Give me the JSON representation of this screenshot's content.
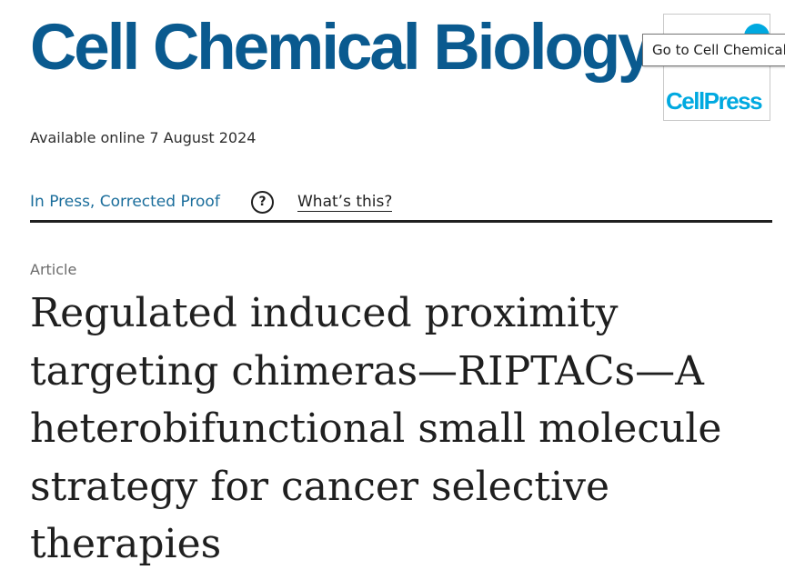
{
  "header": {
    "journal_title": "Cell Chemical Biology",
    "publisher_logo_text": "CellPress",
    "tooltip": "Go to Cell Chemical Biology on ScienceDirect"
  },
  "article": {
    "available_online": "Available online 7 August 2024",
    "status": "In Press, Corrected Proof",
    "help_symbol": "?",
    "whats_this": "What’s this?",
    "type": "Article",
    "title_lines": [
      "Regulated induced proximity",
      "targeting chimeras—RIPTACs—A",
      "heterobifunctional small molecule",
      "strategy for cancer selective",
      "therapies"
    ]
  },
  "colors": {
    "journal_title": "#0a5a8f",
    "publisher_logo": "#00a9e0",
    "status_link": "#1a6d9b"
  }
}
